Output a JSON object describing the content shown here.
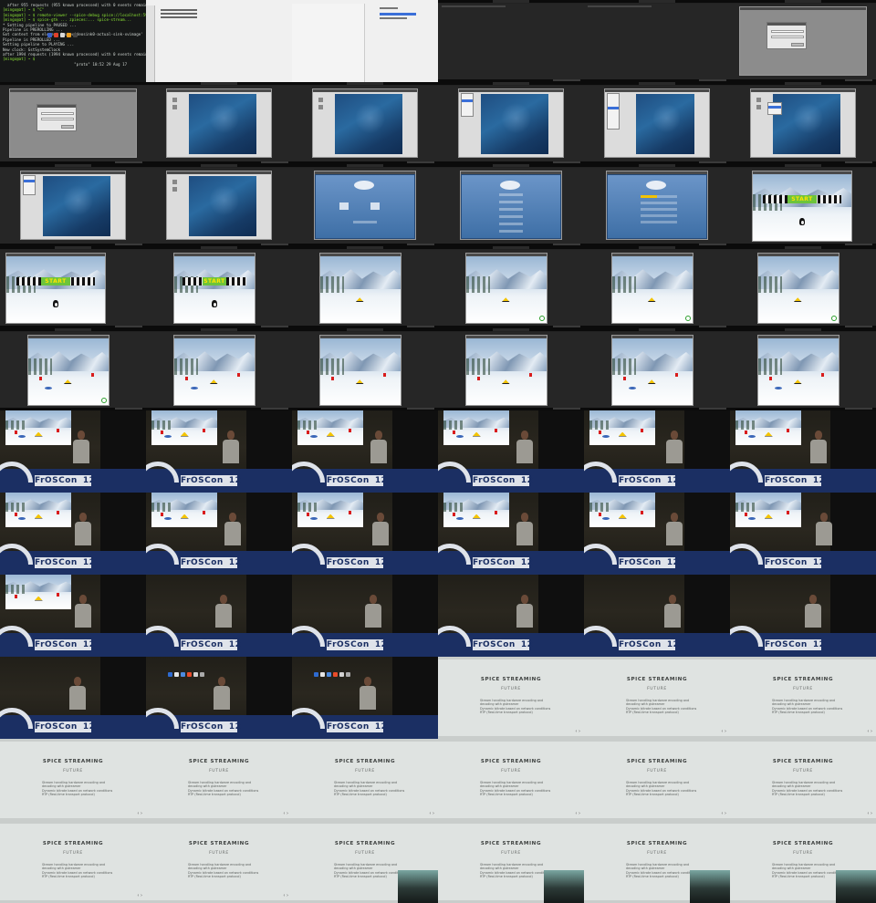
{
  "contact_sheet": {
    "columns": 6,
    "rows": 11,
    "terminal_lines": [
      "  after 955 requests (955 known processed) with 0 events remaining.",
      "[mingo@at] ~ $ \"C\"",
      "[mingo@at] ~ $ remote-viewer --spice-debug spice://localhost:5900*%",
      "[mingo@at] ~ $ spice-gtk ... zpieces:... spice-stream...",
      "* Setting pipeline to PAUSED ...",
      "Pipeline is PREROLLING ...",
      "Got context from element 'autovideosink0-actual-sink-xvimage'",
      "Pipeline is PREROLLED ...",
      "Setting pipeline to PLAYING ...",
      "New clock: GstSystemClock",
      "after 1994 requests (1994 known processed) with 0 events remaining.",
      "[mingo@at] ~ $",
      "                               \"proto\" 10:52 29 Aug 17"
    ],
    "game_banner": "START",
    "conference_logo": {
      "name": "FrOSCon",
      "number": "12"
    },
    "slide": {
      "title": "SPICE STREAMING",
      "subtitle": "FUTURE",
      "bullets": [
        "Stream handling hardware encoding and",
        "decoding with gstreamer",
        "Dynamic bitrate based on network conditions",
        "RTP (Real-time transport protocol)"
      ],
      "nav": "‹ ›"
    },
    "accent_colors": {
      "terminal_bg": "#161818",
      "desktop_blue": "#1f4d80",
      "podium_blue": "#1b2f63",
      "slide_bg": "#dfe3e1",
      "start_green": "#6cc43c"
    }
  }
}
